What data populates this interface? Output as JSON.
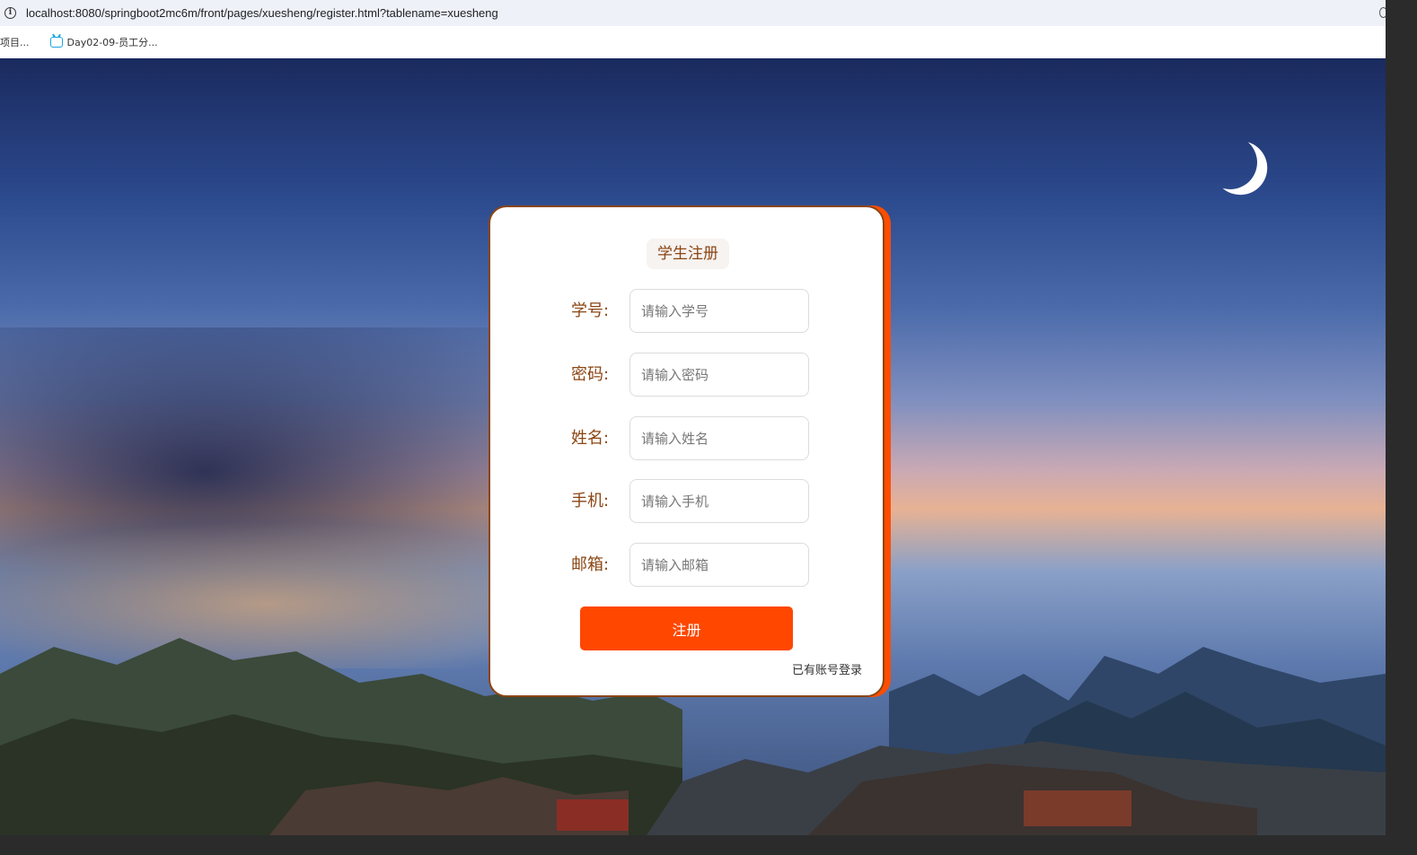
{
  "browser": {
    "url": "localhost:8080/springboot2mc6m/front/pages/xuesheng/register.html?tablename=xuesheng",
    "bookmarks": [
      {
        "label": "项目..."
      },
      {
        "label": "Day02-09-员工分..."
      }
    ]
  },
  "form": {
    "title": "学生注册",
    "fields": [
      {
        "label": "学号:",
        "placeholder": "请输入学号",
        "value": ""
      },
      {
        "label": "密码:",
        "placeholder": "请输入密码",
        "value": ""
      },
      {
        "label": "姓名:",
        "placeholder": "请输入姓名",
        "value": ""
      },
      {
        "label": "手机:",
        "placeholder": "请输入手机",
        "value": ""
      },
      {
        "label": "邮箱:",
        "placeholder": "请输入邮箱",
        "value": ""
      }
    ],
    "submit_label": "注册",
    "login_link": "已有账号登录"
  },
  "colors": {
    "accent": "#ff4700",
    "label": "#8b4513",
    "card_border": "#8b4513"
  }
}
